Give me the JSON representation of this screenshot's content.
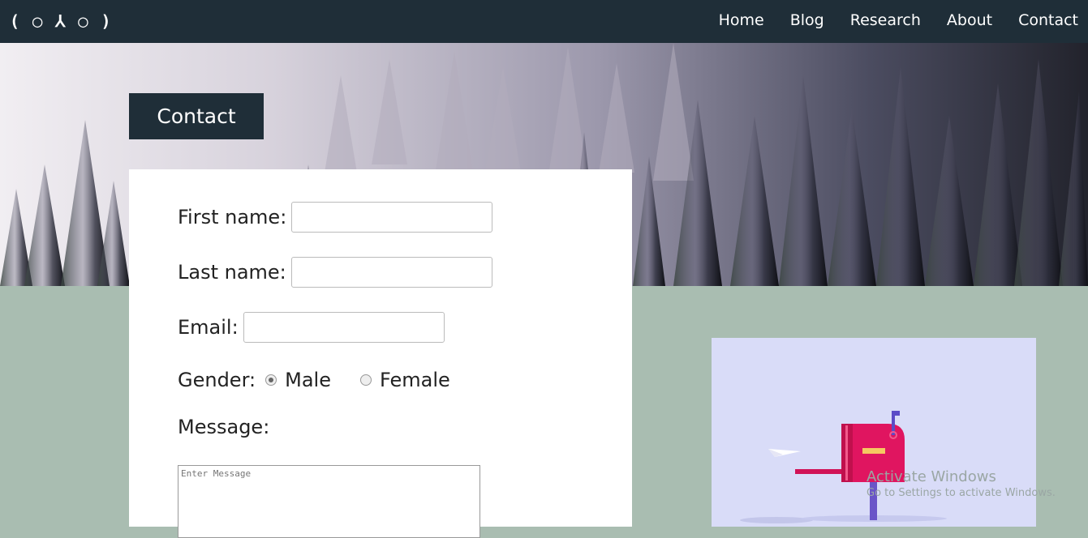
{
  "nav": {
    "logo": "( ◯ ⅄ ◯ )",
    "links": [
      "Home",
      "Blog",
      "Research",
      "About",
      "Contact"
    ]
  },
  "page": {
    "tab_title": "Contact"
  },
  "form": {
    "first_name_label": "First name:",
    "last_name_label": "Last name:",
    "email_label": "Email:",
    "gender_label": "Gender:",
    "gender_options": [
      "Male",
      "Female"
    ],
    "gender_selected": "Male",
    "message_label": "Message:",
    "message_placeholder": "Enter Message"
  },
  "colors": {
    "nav_bg": "#1f2e38",
    "lower_bg": "#a9bdb1",
    "mailbox": "#e01560",
    "card_bg": "#d9dcf8"
  },
  "watermark": {
    "title": "Activate Windows",
    "subtitle": "Go to Settings to activate Windows."
  }
}
